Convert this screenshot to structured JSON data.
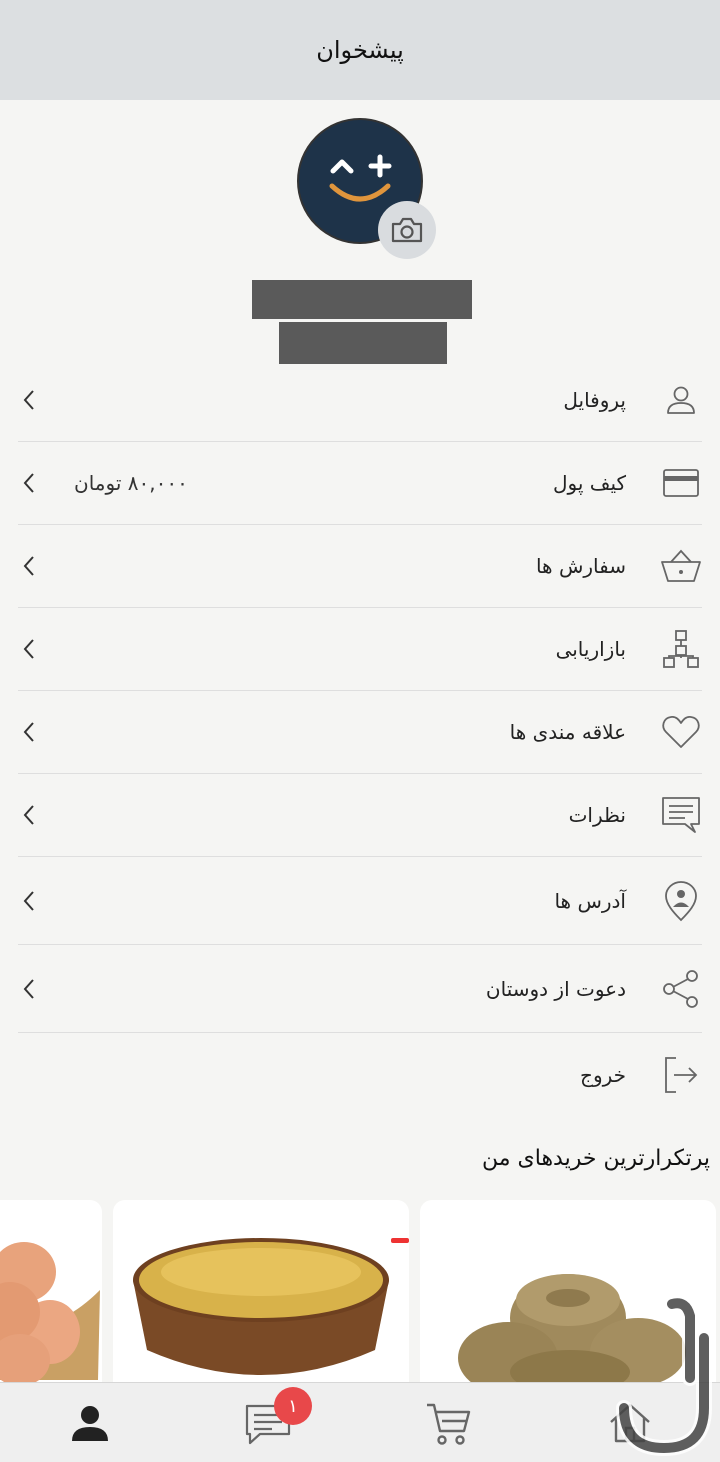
{
  "header": {
    "title": "پیشخوان"
  },
  "colors": {
    "avatar_bg": "#1e3349",
    "smile": "#e0953c",
    "badge": "#e8484a",
    "topbar": "#dcdfe1"
  },
  "menu": {
    "items": [
      {
        "label": "پروفایل",
        "icon": "user-icon"
      },
      {
        "label": "کیف پول",
        "icon": "wallet-card-icon",
        "value": "۸۰,۰۰۰ تومان"
      },
      {
        "label": "سفارش ها",
        "icon": "basket-icon"
      },
      {
        "label": "بازاریابی",
        "icon": "network-icon"
      },
      {
        "label": "علاقه مندی ها",
        "icon": "heart-icon"
      },
      {
        "label": "نظرات",
        "icon": "comment-icon"
      },
      {
        "label": "آدرس ها",
        "icon": "location-pin-icon"
      },
      {
        "label": "دعوت از دوستان",
        "icon": "share-icon"
      },
      {
        "label": "خروج",
        "icon": "logout-icon"
      }
    ]
  },
  "frequent": {
    "title": "پرتکرارترین خریدهای من"
  },
  "bottom_nav": {
    "items": [
      {
        "icon": "home-icon"
      },
      {
        "icon": "cart-icon"
      },
      {
        "icon": "messages-icon",
        "badge": "۱"
      },
      {
        "icon": "profile-icon",
        "active": true
      }
    ]
  }
}
